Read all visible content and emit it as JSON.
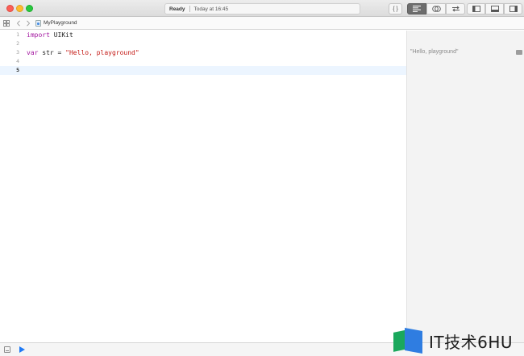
{
  "titlebar": {
    "status": "Ready",
    "time": "Today at 16:45"
  },
  "toolbar": {
    "braces_label": "{ }"
  },
  "jumpbar": {
    "file": "MyPlayground"
  },
  "editor": {
    "lines": [
      {
        "number": "1",
        "keyword": "import",
        "rest": " UIKit"
      },
      {
        "number": "2"
      },
      {
        "number": "3",
        "keyword": "var",
        "rest": " str = ",
        "string": "\"Hello, playground\""
      },
      {
        "number": "4"
      },
      {
        "number": "5"
      }
    ]
  },
  "results": {
    "line3": "\"Hello, playground\""
  },
  "watermark": {
    "text": "IT技术6HU"
  },
  "colors": {
    "keyword": "#a317a0",
    "string": "#c41a16",
    "run": "#1f7af5",
    "current_line": "#ecf5ff"
  }
}
